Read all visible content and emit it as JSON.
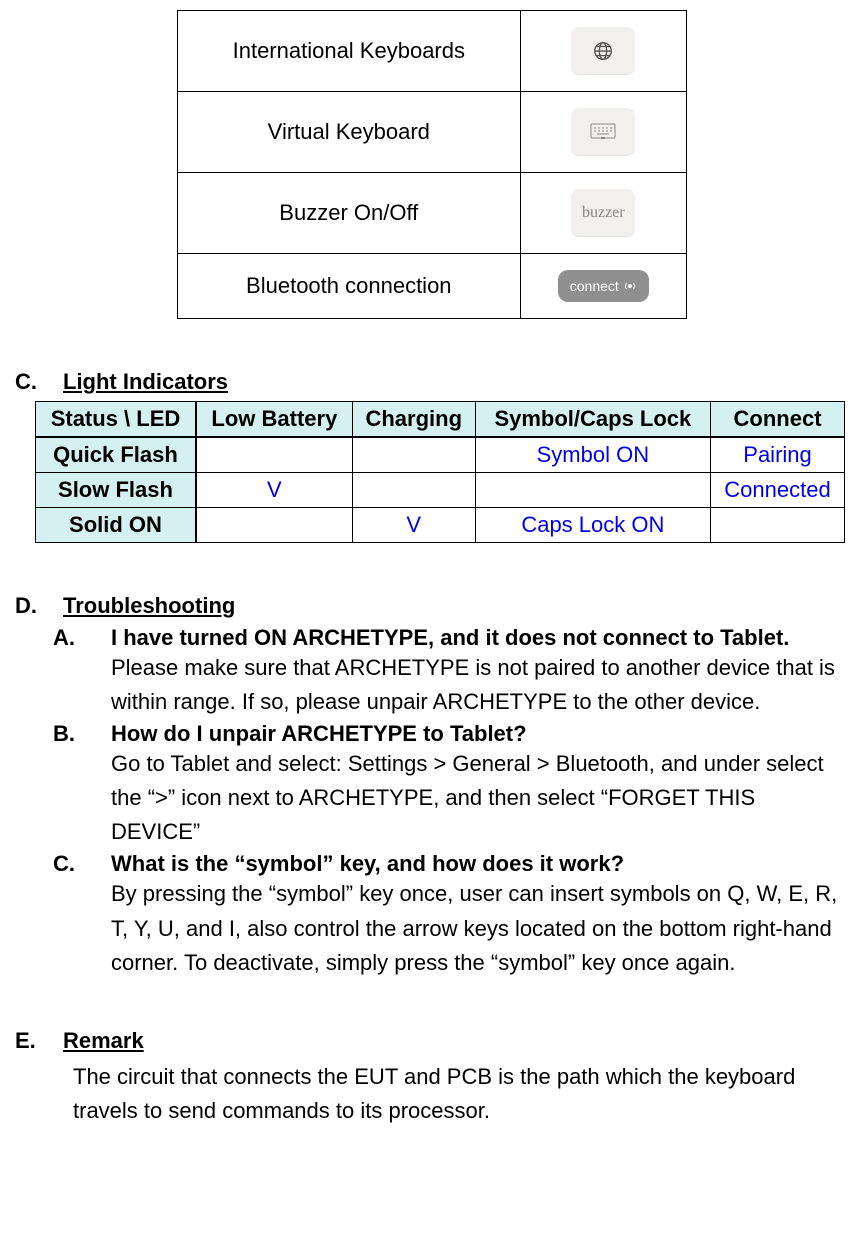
{
  "key_functions": {
    "rows": [
      {
        "label": "International Keyboards",
        "icon": "globe"
      },
      {
        "label": "Virtual Keyboard",
        "icon": "keyboard"
      },
      {
        "label": "Buzzer On/Off",
        "icon": "buzzer_text",
        "text": "buzzer"
      },
      {
        "label": "Bluetooth connection",
        "icon": "connect",
        "text": "connect"
      }
    ]
  },
  "sections": {
    "c_letter": "C.",
    "c_title": "Light Indicators",
    "d_letter": "D.",
    "d_title": "Troubleshooting",
    "e_letter": "E.",
    "e_title": "Remark"
  },
  "led_table": {
    "headers": [
      "Status \\ LED",
      "Low Battery",
      "Charging",
      "Symbol/Caps Lock",
      "Connect"
    ],
    "rows": [
      {
        "name": "Quick Flash",
        "cells": [
          "",
          "",
          "Symbol ON",
          "Pairing"
        ]
      },
      {
        "name": "Slow Flash",
        "cells": [
          "V",
          "",
          "",
          "Connected"
        ]
      },
      {
        "name": "Solid ON",
        "cells": [
          "",
          "V",
          "Caps Lock ON",
          ""
        ]
      }
    ]
  },
  "troubleshooting": {
    "items": [
      {
        "letter": "A.",
        "q": "I have turned ON ARCHETYPE, and it does not connect to Tablet.",
        "a": "Please make sure that ARCHETYPE is not paired to another device that is within range. If so, please unpair ARCHETYPE to the other device."
      },
      {
        "letter": "B.",
        "q": "How do I unpair ARCHETYPE to Tablet?",
        "a": "Go to Tablet and select: Settings > General > Bluetooth, and under select the “>” icon next to ARCHETYPE, and then select “FORGET THIS DEVICE”"
      },
      {
        "letter": "C.",
        "q": "What is the “symbol” key, and how does it work?",
        "a": "By pressing the “symbol” key once, user can insert symbols on Q, W, E, R, T, Y, U, and I, also control the arrow keys located on the bottom right-hand corner.  To deactivate, simply press the “symbol” key once again."
      }
    ]
  },
  "remark": {
    "text": "The circuit that connects the EUT and PCB is the path which the keyboard travels to send commands to its processor."
  }
}
